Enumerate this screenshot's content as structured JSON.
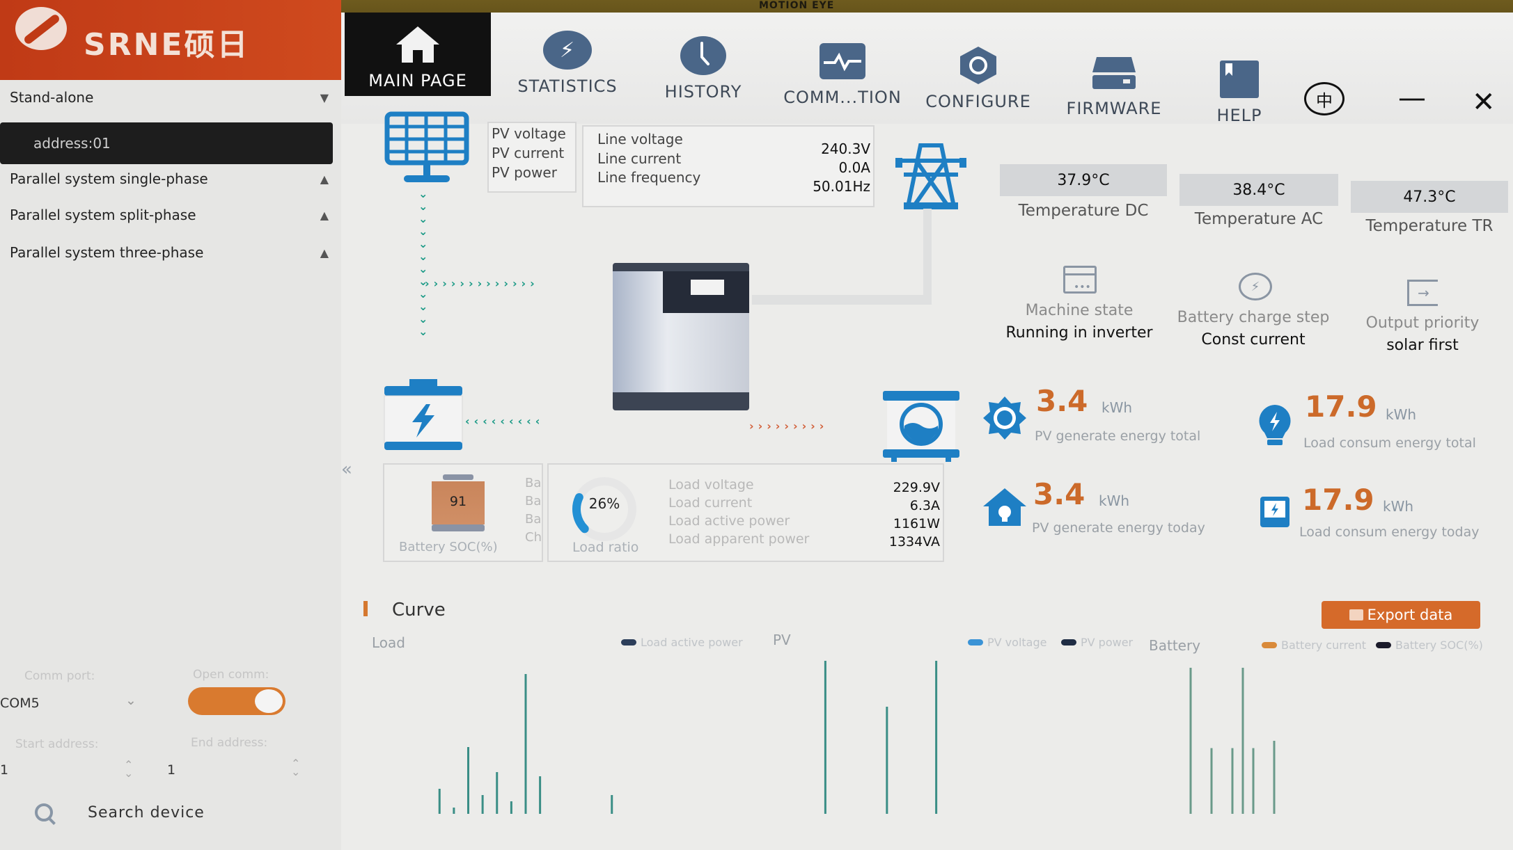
{
  "bezel": {
    "label": "MOTION EYE"
  },
  "brand": {
    "name": "SRNE硕日"
  },
  "sidebar": {
    "groups": [
      {
        "label": "Stand-alone",
        "expanded": true
      },
      {
        "label": "Parallel system single-phase",
        "expanded": false
      },
      {
        "label": "Parallel system split-phase",
        "expanded": false
      },
      {
        "label": "Parallel system three-phase",
        "expanded": false
      }
    ],
    "device": {
      "label": "address:01",
      "status": "online",
      "status_color": "#1fa37a"
    },
    "comm": {
      "port_label": "Comm port:",
      "port_value": "COM5",
      "open_label": "Open comm:",
      "open_state": true,
      "start_label": "Start address:",
      "start_value": "1",
      "end_label": "End address:",
      "end_value": "1"
    },
    "search_label": "Search device",
    "collapse_icon": "double-chevron-left-icon"
  },
  "nav": {
    "items": [
      {
        "label": "MAIN PAGE",
        "icon": "home-icon",
        "active": true
      },
      {
        "label": "STATISTICS",
        "icon": "lightning-icon",
        "active": false
      },
      {
        "label": "HISTORY",
        "icon": "clock-icon",
        "active": false
      },
      {
        "label": "COMM...TION",
        "icon": "pulse-icon",
        "active": false
      },
      {
        "label": "CONFIGURE",
        "icon": "hex-nut-icon",
        "active": false
      },
      {
        "label": "FIRMWARE",
        "icon": "drive-icon",
        "active": false
      },
      {
        "label": "HELP",
        "icon": "book-icon",
        "active": false
      }
    ],
    "language_label": "中",
    "minimize_label": "—",
    "close_label": "✕"
  },
  "pv": {
    "labels": [
      "PV voltage",
      "PV current",
      "PV power"
    ]
  },
  "line": {
    "labels": [
      "Line voltage",
      "Line current",
      "Line frequency"
    ],
    "values": [
      "240.3V",
      "0.0A",
      "50.01Hz"
    ]
  },
  "temperatures": [
    {
      "value": "37.9°C",
      "label": "Temperature DC"
    },
    {
      "value": "38.4°C",
      "label": "Temperature AC"
    },
    {
      "value": "47.3°C",
      "label": "Temperature TR"
    }
  ],
  "states": [
    {
      "label": "Machine state",
      "value": "Running in inverter",
      "icon": "machine-icon"
    },
    {
      "label": "Battery charge step",
      "value": "Const current",
      "icon": "charge-icon"
    },
    {
      "label": "Output priority",
      "value": "solar first",
      "icon": "output-icon"
    }
  ],
  "energy": [
    {
      "value": "3.4",
      "unit": "kWh",
      "label": "PV generate energy total",
      "icon": "sun-icon"
    },
    {
      "value": "17.9",
      "unit": "kWh",
      "label": "Load consum energy total",
      "icon": "bulb-icon"
    },
    {
      "value": "3.4",
      "unit": "kWh",
      "label": "PV generate energy today",
      "icon": "house-icon"
    },
    {
      "value": "17.9",
      "unit": "kWh",
      "label": "Load consum energy today",
      "icon": "meter-icon"
    }
  ],
  "battery": {
    "soc": "91",
    "soc_label": "Battery SOC(%)",
    "truncated_labels": [
      "Ba",
      "Ba",
      "Ba",
      "Ch"
    ]
  },
  "load": {
    "ratio_percent": 26,
    "ratio_text": "26%",
    "ratio_label": "Load ratio",
    "labels": [
      "Load voltage",
      "Load current",
      "Load active power",
      "Load apparent power"
    ],
    "values": [
      "229.9V",
      "6.3A",
      "1161W",
      "1334VA"
    ]
  },
  "curve": {
    "title": "Curve",
    "export_label": "Export data"
  },
  "colors": {
    "brand": "#c9411b",
    "accent_orange": "#d56a2a",
    "icon_blue": "#1e7fc4",
    "flow_green": "#1b9a86",
    "flow_orange": "#d2603a"
  },
  "chart_data": [
    {
      "type": "line",
      "title": "Load",
      "legend": [
        {
          "name": "Load active power",
          "color": "#2c3e5a"
        }
      ],
      "series": [
        {
          "name": "Load active power",
          "values": [
            0,
            1200,
            300,
            3200,
            900,
            2000,
            600,
            6700,
            1800,
            0,
            0,
            0,
            0,
            900,
            0
          ]
        }
      ]
    },
    {
      "type": "line",
      "title": "PV",
      "legend": [
        {
          "name": "PV voltage",
          "color": "#3a93d6"
        },
        {
          "name": "PV power",
          "color": "#1f2d44"
        }
      ],
      "series": [
        {
          "name": "PV voltage",
          "values": [
            0,
            100,
            0,
            0,
            0,
            0,
            70,
            0,
            0,
            0,
            100,
            0
          ]
        }
      ]
    },
    {
      "type": "line",
      "title": "Battery",
      "legend": [
        {
          "name": "Battery current",
          "color": "#d98a3a"
        },
        {
          "name": "Battery SOC(%)",
          "color": "#1a1a2a"
        }
      ],
      "series": [
        {
          "name": "Battery current",
          "values": [
            0,
            100,
            0,
            45,
            0,
            45,
            100,
            45,
            0,
            50,
            0
          ]
        }
      ]
    }
  ]
}
